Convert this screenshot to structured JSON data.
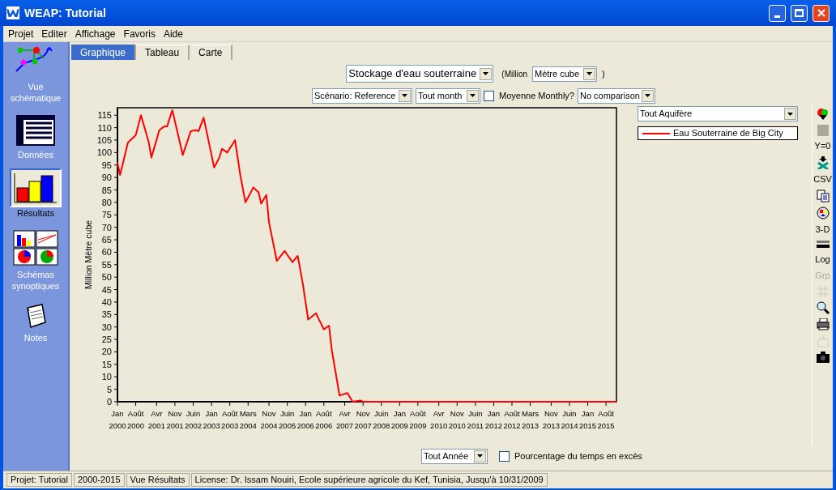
{
  "window": {
    "title": "WEAP: Tutorial"
  },
  "menu": [
    "Projet",
    "Editer",
    "Affichage",
    "Favoris",
    "Aide"
  ],
  "sidebar": {
    "items": [
      {
        "kind": "schematic",
        "label": "Vue\nschématique",
        "selected": false
      },
      {
        "kind": "data",
        "label": "Données",
        "selected": false
      },
      {
        "kind": "results",
        "label": "Résultats",
        "selected": true
      },
      {
        "kind": "overviews",
        "label": "Schémas\nsynoptiques",
        "selected": false
      },
      {
        "kind": "notes",
        "label": "Notes",
        "selected": false
      }
    ]
  },
  "tabs": [
    {
      "label": "Graphique",
      "selected": true
    },
    {
      "label": "Tableau",
      "selected": false
    },
    {
      "label": "Carte",
      "selected": false
    }
  ],
  "variable_select": {
    "value": "Stockage d'eau souterraine"
  },
  "unit_prefix": "(Million",
  "unit_select": {
    "value": "Mètre cube"
  },
  "unit_suffix": ")",
  "scenario_select": {
    "value": "Scénario: Reference"
  },
  "month_select": {
    "value": "Tout month"
  },
  "monthly_average": {
    "label": "Moyenne Monthly?",
    "checked": false
  },
  "comparison_select": {
    "value": "No comparison"
  },
  "aquifer_select": {
    "value": "Tout Aquifère"
  },
  "toolbar": [
    {
      "kind": "paint",
      "disabled": false
    },
    {
      "kind": "square",
      "disabled": false
    },
    {
      "kind": "text",
      "label": "Y=0",
      "disabled": false
    },
    {
      "kind": "export",
      "disabled": false
    },
    {
      "kind": "text",
      "label": "CSV",
      "disabled": false
    },
    {
      "kind": "copy",
      "disabled": false
    },
    {
      "kind": "palette",
      "disabled": false
    },
    {
      "kind": "text",
      "label": "3-D",
      "disabled": false
    },
    {
      "kind": "lines",
      "disabled": false
    },
    {
      "kind": "text",
      "label": "Log",
      "disabled": false
    },
    {
      "kind": "text",
      "label": "Grp",
      "disabled": true
    },
    {
      "kind": "grid",
      "disabled": true
    },
    {
      "kind": "search",
      "disabled": false
    },
    {
      "kind": "print",
      "disabled": false
    },
    {
      "kind": "brush",
      "disabled": true
    },
    {
      "kind": "camera",
      "disabled": false
    }
  ],
  "chart": {
    "chart_data": {
      "type": "line",
      "ylabel": "Million Mètre cube",
      "ylim": [
        0,
        118
      ],
      "categories": [
        "Jan\n2000",
        null,
        null,
        null,
        null,
        null,
        null,
        "Août\n2000",
        null,
        null,
        null,
        null,
        null,
        null,
        null,
        "Avr\n2001",
        null,
        null,
        null,
        null,
        null,
        null,
        "Nov\n2001",
        null,
        null,
        null,
        null,
        null,
        null,
        "Juin\n2002",
        null,
        null,
        null,
        null,
        null,
        null,
        "Jan\n2003",
        null,
        null,
        null,
        null,
        null,
        null,
        "Août\n2003",
        null,
        null,
        null,
        null,
        null,
        null,
        "Mars\n2004",
        null,
        null,
        null,
        null,
        null,
        null,
        null,
        "Nov\n2004",
        null,
        null,
        null,
        null,
        null,
        null,
        "Juin\n2005",
        null,
        null,
        null,
        null,
        null,
        null,
        "Jan\n2006",
        null,
        null,
        null,
        null,
        null,
        null,
        "Août\n2006",
        null,
        null,
        null,
        null,
        null,
        null,
        null,
        "Avr\n2007",
        null,
        null,
        null,
        null,
        null,
        null,
        "Nov\n2007",
        null,
        null,
        null,
        null,
        null,
        null,
        "Juin\n2008",
        null,
        null,
        null,
        null,
        null,
        null,
        "Jan\n2009",
        null,
        null,
        null,
        null,
        null,
        null,
        "Août\n2009",
        null,
        null,
        null,
        null,
        null,
        null,
        null,
        "Avr\n2010",
        null,
        null,
        null,
        null,
        null,
        null,
        "Nov\n2010",
        null,
        null,
        null,
        null,
        null,
        null,
        "Juin\n2011",
        null,
        null,
        null,
        null,
        null,
        null,
        "Jan\n2012",
        null,
        null,
        null,
        null,
        null,
        null,
        "Août\n2012",
        null,
        null,
        null,
        null,
        null,
        null,
        "Mars\n2013",
        null,
        null,
        null,
        null,
        null,
        null,
        null,
        "Nov\n2013",
        null,
        null,
        null,
        null,
        null,
        null,
        "Juin\n2014",
        null,
        null,
        null,
        null,
        null,
        null,
        "Jan\n2015",
        null,
        null,
        null,
        null,
        null,
        null,
        "Août\n2015",
        null,
        null,
        null,
        null
      ],
      "series": [
        {
          "name": "Eau Souterraine de Big City",
          "color": "#ff0000",
          "values": [
            96,
            91,
            95.3,
            99.7,
            104,
            105,
            106,
            107,
            111,
            115,
            111.3,
            107.7,
            104,
            98,
            101.7,
            105.3,
            109,
            109.8,
            110.5,
            110.5,
            113.8,
            117,
            112.5,
            108,
            103.5,
            99,
            102.2,
            105.3,
            108.5,
            108.8,
            109,
            108.5,
            111.3,
            114,
            109,
            104,
            99,
            94,
            96,
            98,
            101.5,
            100.8,
            100,
            101.7,
            103.3,
            105,
            98,
            91,
            85.5,
            80,
            82,
            84,
            86,
            85,
            84,
            79.5,
            81.3,
            83,
            72,
            66.8,
            61.7,
            56.5,
            57.8,
            59.2,
            60.5,
            59,
            57.5,
            56,
            57.3,
            58.5,
            52.8,
            47,
            40,
            33,
            33.8,
            34.7,
            35.5,
            33.3,
            31.2,
            29,
            29.8,
            30.5,
            21,
            14.8,
            8.7,
            2.5,
            2.8,
            3.2,
            3.5,
            1.8,
            0,
            0.2,
            0.3,
            0.5,
            0,
            0,
            0,
            0,
            0,
            0,
            0,
            0,
            0,
            0,
            0,
            0,
            0,
            0,
            0,
            0,
            0,
            0,
            0,
            0,
            0,
            0,
            0,
            0,
            0,
            0,
            0,
            0,
            0,
            0,
            0,
            0,
            0,
            0,
            0,
            0,
            0,
            0,
            0,
            0,
            0,
            0,
            0,
            0,
            0,
            0,
            0,
            0,
            0,
            0,
            0,
            0,
            0,
            0,
            0,
            0,
            0,
            0,
            0,
            0,
            0,
            0,
            0,
            0,
            0,
            0,
            0,
            0,
            0,
            0,
            0,
            0,
            0,
            0,
            0,
            0,
            0,
            0,
            0,
            0,
            0,
            0,
            0,
            0,
            0,
            0,
            0,
            0,
            0,
            0,
            0,
            0,
            0,
            0,
            0,
            0,
            0,
            0
          ]
        }
      ],
      "yticks": [
        0,
        5,
        10,
        15,
        20,
        25,
        30,
        35,
        40,
        45,
        50,
        55,
        60,
        65,
        70,
        75,
        80,
        85,
        90,
        95,
        100,
        105,
        110,
        115
      ]
    }
  },
  "year_select": {
    "value": "Tout Année"
  },
  "exceedance": {
    "label": "Pourcentage du temps en excès",
    "checked": false
  },
  "status_bar": [
    "Projet: Tutorial",
    "2000-2015",
    "Vue Résultats",
    "License: Dr. Issam Nouiri, Ecole supérieure agricole du Kef, Tunisia, Jusqu'à 10/31/2009"
  ]
}
